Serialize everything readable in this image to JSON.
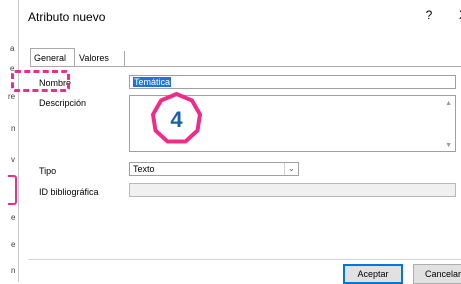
{
  "background_strip": {
    "fragments": [
      "a",
      "e",
      "re",
      "n",
      "v",
      "e",
      "e",
      "n"
    ]
  },
  "dialog": {
    "title": "Atributo nuevo",
    "help_glyph": "?",
    "close_glyph": "X",
    "tabs": [
      {
        "label": "General",
        "active": true
      },
      {
        "label": "Valores",
        "active": false
      }
    ],
    "fields": {
      "nombre_label": "Nombre",
      "nombre_value": "Temática",
      "descripcion_label": "Descripción",
      "descripcion_value": "",
      "tipo_label": "Tipo",
      "tipo_value": "Texto",
      "id_label": "ID bibliográfica",
      "id_value": ""
    },
    "buttons": {
      "ok": "Aceptar",
      "cancel": "Cancelar"
    }
  },
  "annotation": {
    "step_number": "4",
    "color": "#ee2d8b",
    "number_color": "#1a5fa8"
  },
  "icons": [
    "help-icon",
    "close-icon",
    "chevron-down-icon",
    "scroll-up-icon",
    "scroll-down-icon"
  ]
}
